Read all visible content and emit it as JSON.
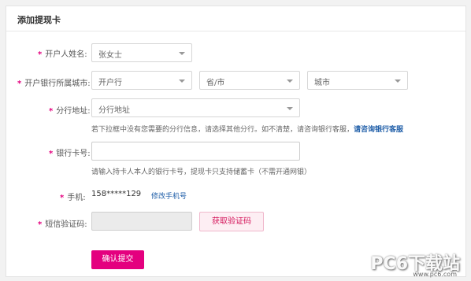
{
  "title": "添加提现卡",
  "required_mark": "*",
  "holder": {
    "label": "开户人姓名:",
    "value": "张女士"
  },
  "bank_city": {
    "label": "开户银行所属城市:",
    "bank": "开户行",
    "province": "省/市",
    "city": "城市"
  },
  "branch": {
    "label": "分行地址:",
    "value": "分行地址",
    "hint": "若下拉框中没有您需要的分行信息，请选择其他分行。如不清楚，请咨询银行客服，",
    "hint_link": "请咨询银行客服"
  },
  "card": {
    "label": "银行卡号:",
    "value": "",
    "hint": "请输入持卡人本人的银行卡号，提现卡只支持储蓄卡（不需开通网银）"
  },
  "phone": {
    "label": "手机:",
    "value": "158*****129",
    "change_link": "修改手机号"
  },
  "sms": {
    "label": "短信验证码:",
    "value": "",
    "get_code": "获取验证码"
  },
  "submit": "确认提交",
  "watermark": {
    "text": "PC6下载站",
    "url": "www.pc6.com"
  },
  "colors": {
    "accent": "#e4007f",
    "link": "#1f5ea8"
  }
}
